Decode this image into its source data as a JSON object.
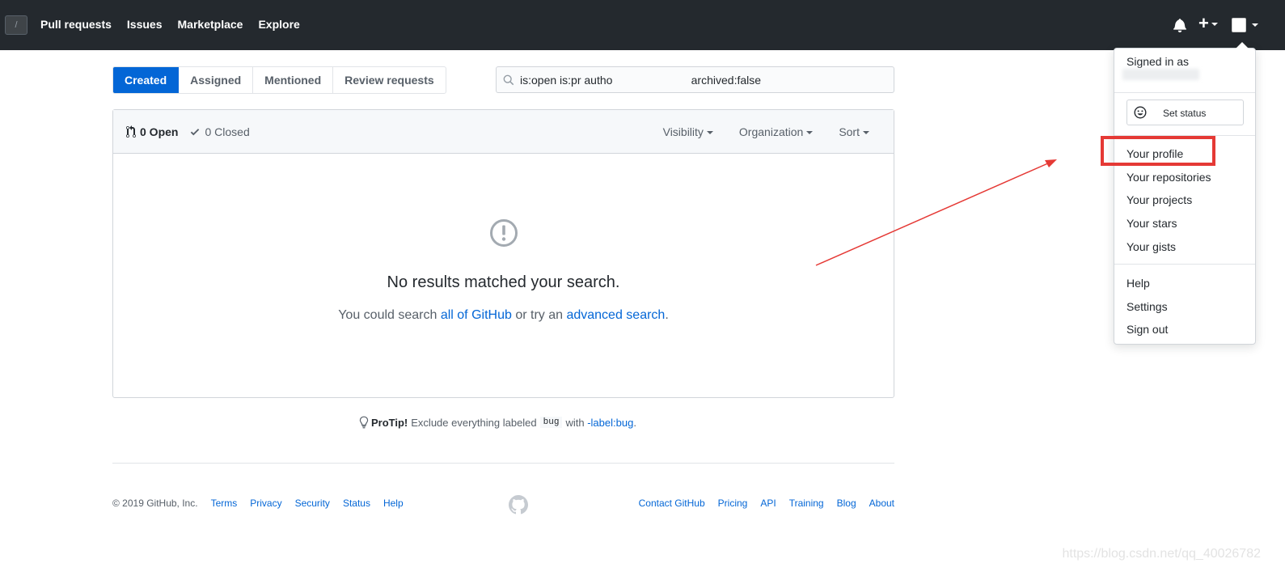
{
  "header": {
    "slash_key": "/",
    "nav": [
      "Pull requests",
      "Issues",
      "Marketplace",
      "Explore"
    ]
  },
  "tabs": [
    "Created",
    "Assigned",
    "Mentioned",
    "Review requests"
  ],
  "search": {
    "value": "is:open is:pr autho                         archived:false"
  },
  "box": {
    "open_label": "0 Open",
    "closed_label": "0 Closed",
    "filters": [
      "Visibility",
      "Organization",
      "Sort"
    ],
    "blank_title": "No results matched your search.",
    "blank_text_1": "You could search ",
    "blank_link_1": "all of GitHub",
    "blank_text_2": " or try an ",
    "blank_link_2": "advanced search",
    "blank_text_3": "."
  },
  "protip": {
    "label": "ProTip!",
    "text": "Exclude everything labeled",
    "code": "bug",
    "with": "with",
    "link": "-label:bug",
    "end": "."
  },
  "footer": {
    "copyright": "© 2019 GitHub, Inc.",
    "left_links": [
      "Terms",
      "Privacy",
      "Security",
      "Status",
      "Help"
    ],
    "right_links": [
      "Contact GitHub",
      "Pricing",
      "API",
      "Training",
      "Blog",
      "About"
    ]
  },
  "dropdown": {
    "signed_in_as": "Signed in as",
    "set_status": "Set status",
    "items_1": [
      "Your profile",
      "Your repositories",
      "Your projects",
      "Your stars",
      "Your gists"
    ],
    "items_2": [
      "Help",
      "Settings",
      "Sign out"
    ]
  },
  "watermark": "https://blog.csdn.net/qq_40026782",
  "colors": {
    "header_bg": "#24292e",
    "accent": "#0366d6",
    "annotation": "#e53935"
  }
}
